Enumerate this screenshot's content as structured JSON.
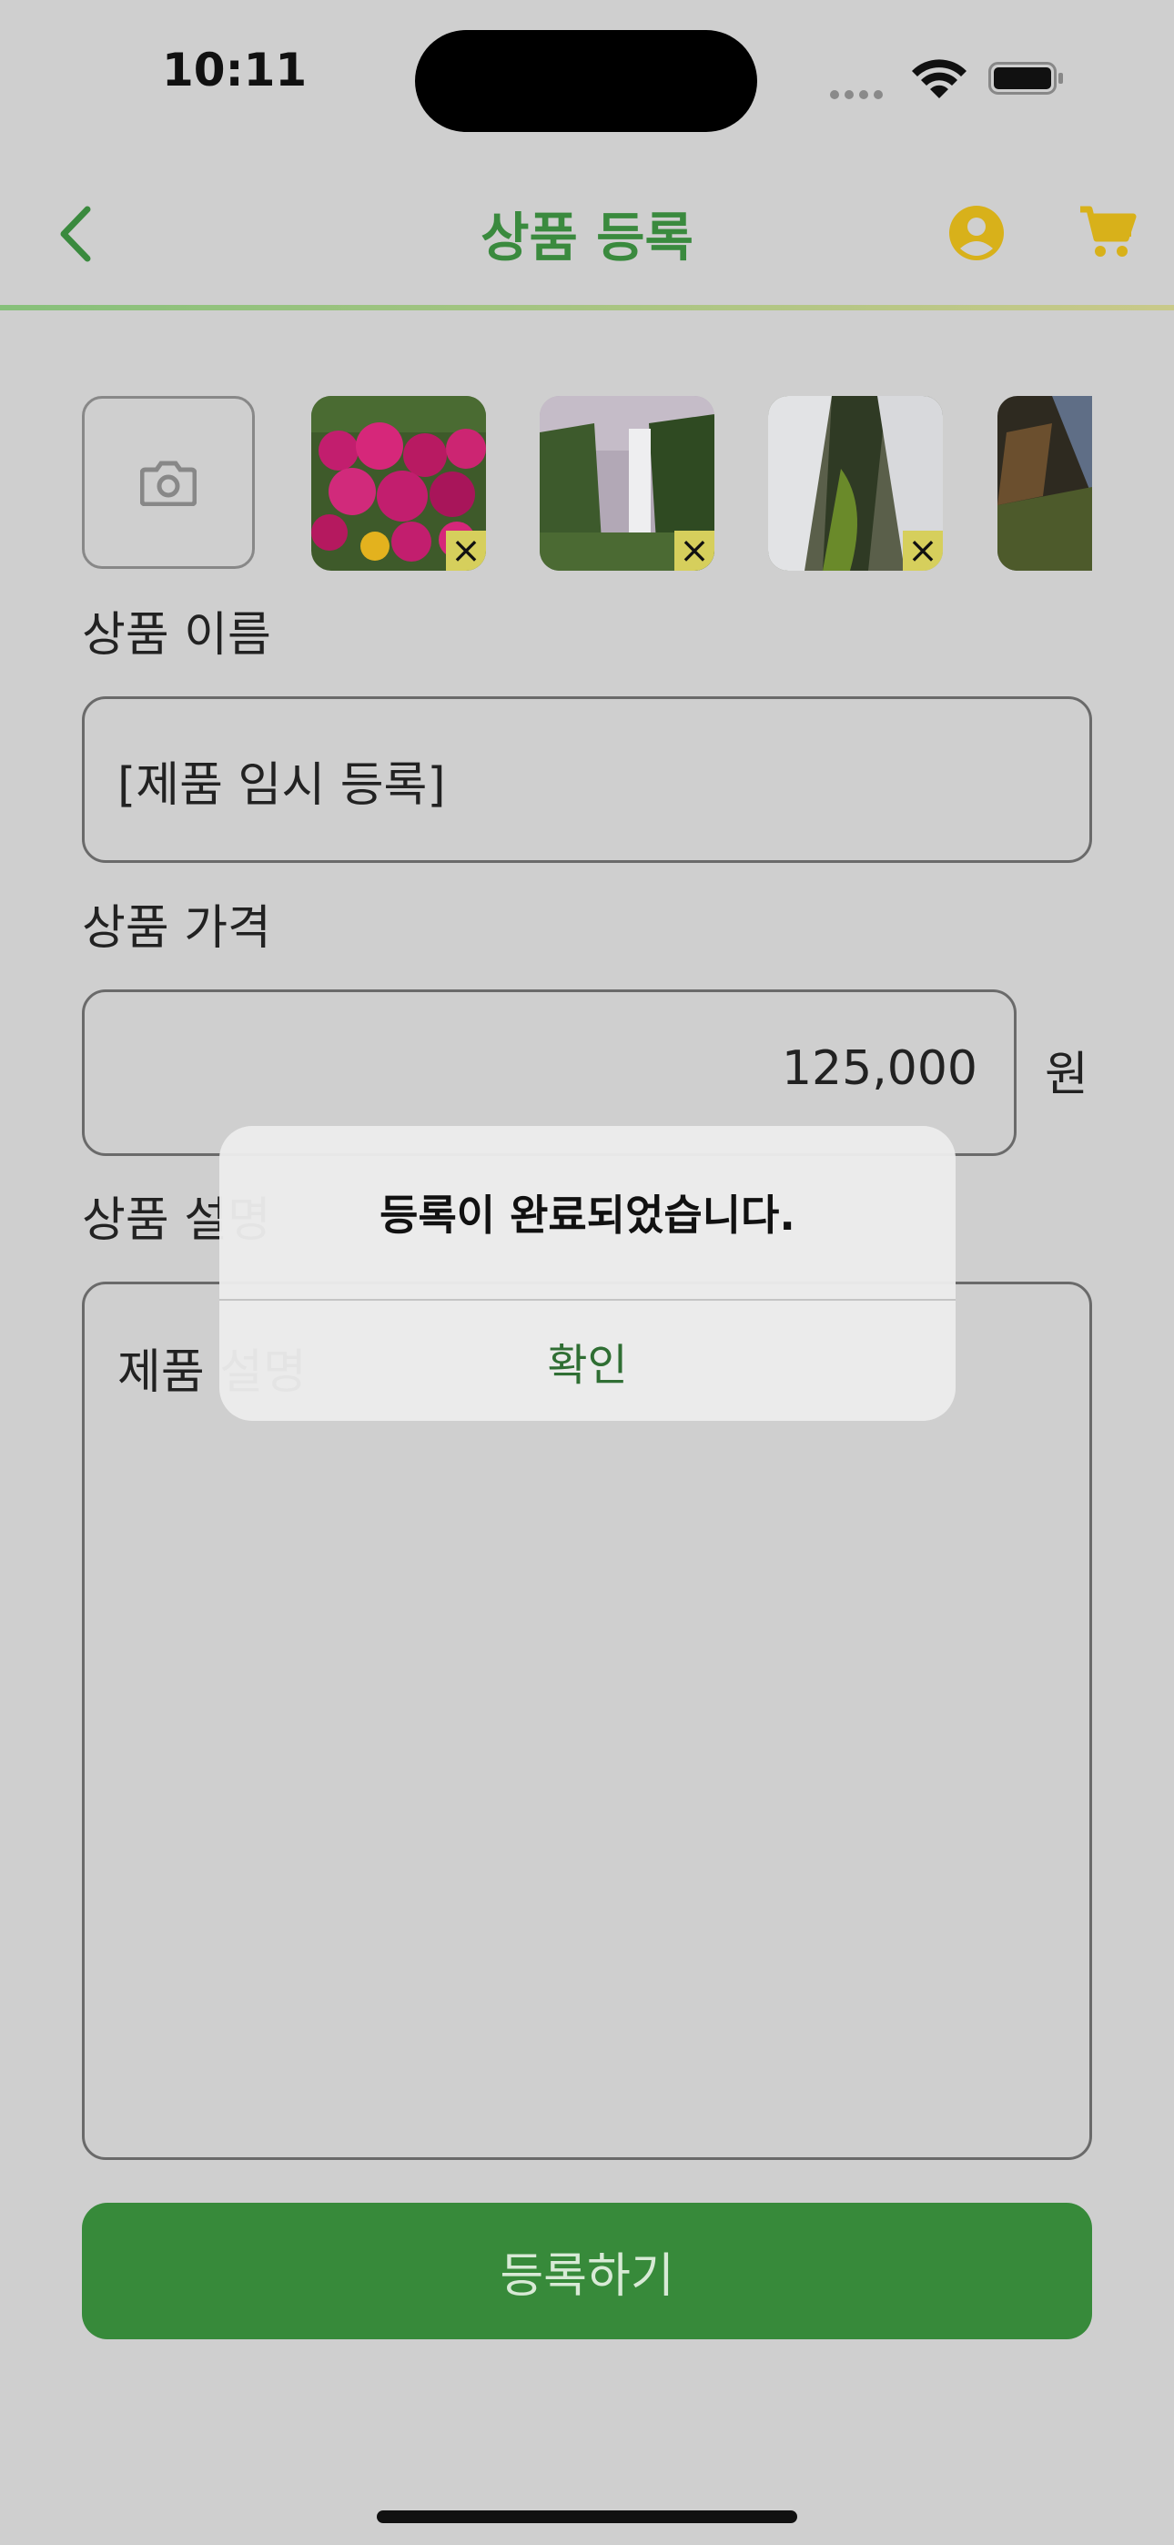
{
  "status": {
    "time": "10:11"
  },
  "nav": {
    "title": "상품 등록",
    "back_icon": "chevron-left-icon",
    "profile_icon": "account-circle-icon",
    "cart_icon": "cart-icon",
    "accent": "#3a8a3e",
    "icon_color": "#d8b11a"
  },
  "images": {
    "camera_icon": "camera-icon",
    "remove_label": "×"
  },
  "form": {
    "name_label": "상품 이름",
    "name_value": "[제품 임시 등록]",
    "price_label": "상품 가격",
    "price_value": "125,000",
    "price_unit": "원",
    "desc_label": "상품 설명",
    "desc_value": "제품 설명"
  },
  "submit_label": "등록하기",
  "alert": {
    "message": "등록이 완료되었습니다.",
    "confirm_label": "확인"
  }
}
